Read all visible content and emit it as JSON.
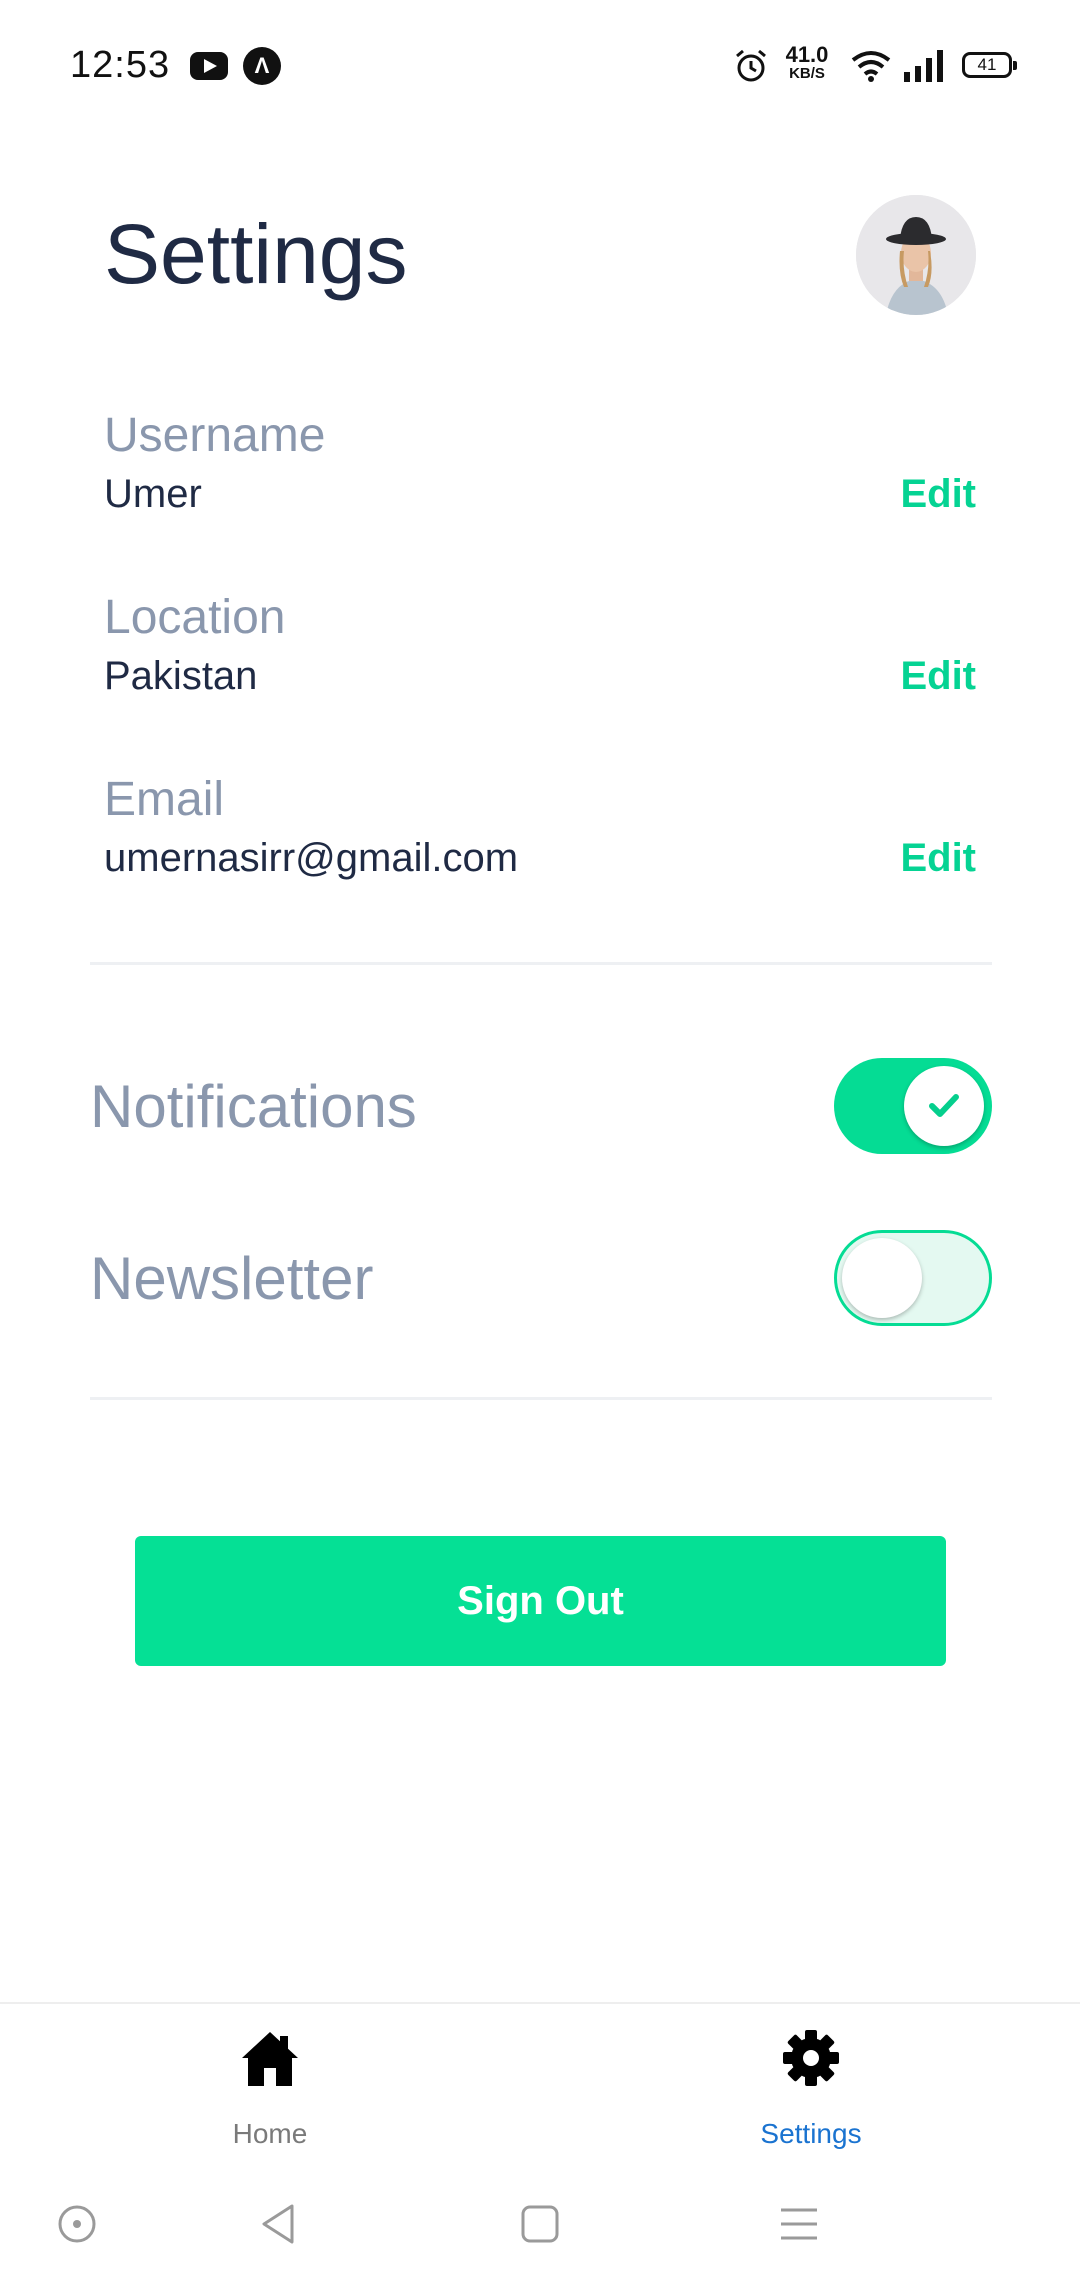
{
  "status_bar": {
    "time": "12:53",
    "speed_value": "41.0",
    "speed_unit": "KB/S",
    "battery": "41",
    "icons": [
      "youtube-icon",
      "a-icon",
      "alarm-icon",
      "wifi-icon",
      "signal-icon",
      "battery-icon"
    ],
    "a_icon_glyph": "Λ"
  },
  "header": {
    "title": "Settings",
    "avatar": "avatar"
  },
  "profile": {
    "fields": [
      {
        "label": "Username",
        "value": "Umer",
        "action": "Edit"
      },
      {
        "label": "Location",
        "value": "Pakistan",
        "action": "Edit"
      },
      {
        "label": "Email",
        "value": "umernasirr@gmail.com",
        "action": "Edit"
      }
    ]
  },
  "preferences": {
    "notifications": {
      "label": "Notifications",
      "enabled": true
    },
    "newsletter": {
      "label": "Newsletter",
      "enabled": false
    }
  },
  "actions": {
    "sign_out": "Sign Out"
  },
  "tabbar": {
    "tabs": [
      {
        "label": "Home",
        "icon": "home-icon",
        "active": false
      },
      {
        "label": "Settings",
        "icon": "gear-icon",
        "active": true
      }
    ]
  },
  "system_nav": {
    "buttons": [
      "assistant-icon",
      "back-icon",
      "home-square-icon",
      "menu-icon"
    ]
  },
  "colors": {
    "accent": "#05dc94",
    "title": "#1f2a44",
    "label": "#8a97ad",
    "tab_active": "#1a73d0",
    "tab_inactive": "#7a7a7a"
  }
}
